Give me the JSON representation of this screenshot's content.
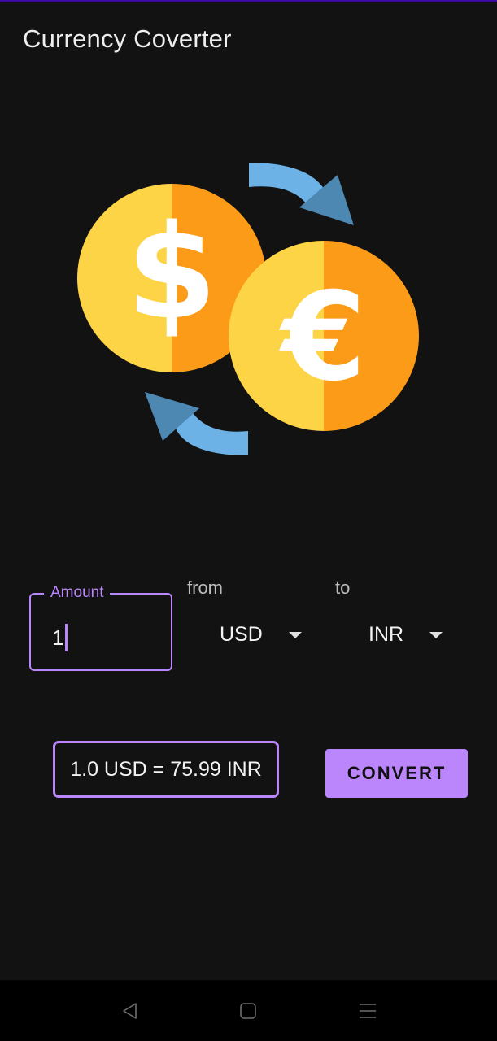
{
  "app": {
    "title": "Currency Coverter"
  },
  "colors": {
    "accent": "#bb86fc",
    "background": "#121212",
    "coin_light": "#fdd446",
    "coin_dark": "#fc9b17",
    "arrow_light": "#6db2e6",
    "arrow_dark": "#4d88b3"
  },
  "illustration": {
    "icons": [
      "dollar-coin",
      "euro-coin",
      "exchange-arrows"
    ]
  },
  "amount": {
    "label": "Amount",
    "value": "1"
  },
  "from": {
    "label": "from",
    "selected": "USD"
  },
  "to": {
    "label": "to",
    "selected": "INR"
  },
  "result": {
    "text": "1.0 USD = 75.99 INR"
  },
  "convert": {
    "label": "CONVERT"
  },
  "nav": {
    "icons": [
      "back-icon",
      "home-icon",
      "menu-icon"
    ]
  }
}
